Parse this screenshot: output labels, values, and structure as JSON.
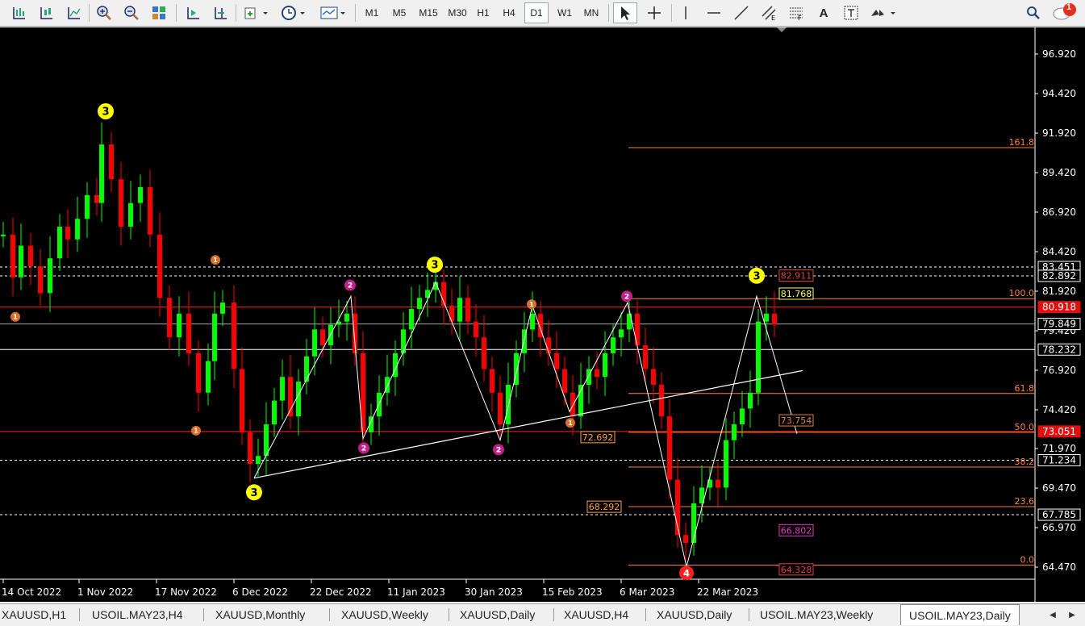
{
  "toolbar": {
    "timeframes": [
      "M1",
      "M5",
      "M15",
      "M30",
      "H1",
      "H4",
      "D1",
      "W1",
      "MN"
    ],
    "active_timeframe": "D1",
    "text_tool_label": "A",
    "notification_count": "1"
  },
  "chart_data": {
    "type": "candlestick",
    "symbol": "USOIL.MAY23",
    "timeframe": "Daily",
    "y_ticks": [
      "96.920",
      "94.420",
      "91.920",
      "89.420",
      "86.920",
      "84.420",
      "81.920",
      "79.420",
      "76.920",
      "74.420",
      "71.970",
      "69.470",
      "66.970",
      "64.470"
    ],
    "y_tick_values": [
      96.92,
      94.42,
      91.92,
      89.42,
      86.92,
      84.42,
      81.92,
      79.42,
      76.92,
      74.42,
      71.97,
      69.47,
      66.97,
      64.47
    ],
    "x_ticks": [
      "14 Oct 2022",
      "1 Nov 2022",
      "17 Nov 2022",
      "6 Dec 2022",
      "22 Dec 2022",
      "11 Jan 2023",
      "30 Jan 2023",
      "15 Feb 2023",
      "6 Mar 2023",
      "22 Mar 2023"
    ],
    "price_labels": [
      {
        "text": "83.451",
        "value": 83.451,
        "style": "white"
      },
      {
        "text": "82.892",
        "value": 82.892,
        "style": "white"
      },
      {
        "text": "80.918",
        "value": 80.918,
        "style": "red"
      },
      {
        "text": "79.849",
        "value": 79.849,
        "style": "white"
      },
      {
        "text": "78.232",
        "value": 78.232,
        "style": "white"
      },
      {
        "text": "73.051",
        "value": 73.051,
        "style": "red"
      },
      {
        "text": "71.234",
        "value": 71.234,
        "style": "white"
      },
      {
        "text": "67.785",
        "value": 67.785,
        "style": "white"
      }
    ],
    "fib_levels": [
      {
        "label": "161.8",
        "value": 91.0
      },
      {
        "label": "100.0",
        "value": 81.45
      },
      {
        "label": "61.8",
        "value": 75.45
      },
      {
        "label": "50.0",
        "value": 73.0
      },
      {
        "label": "38.2",
        "value": 70.8
      },
      {
        "label": "23.6",
        "value": 68.3
      },
      {
        "label": "0.0",
        "value": 64.6
      }
    ],
    "chart_labels": [
      {
        "text": "82.911",
        "value": 82.911,
        "color": "#e04040"
      },
      {
        "text": "81.768",
        "value": 81.768,
        "color": "#ffff66"
      },
      {
        "text": "73.754",
        "value": 73.754,
        "color": "#e08040"
      },
      {
        "text": "72.692",
        "value": 72.692,
        "color": "#ffa040"
      },
      {
        "text": "68.292",
        "value": 68.292,
        "color": "#ffa040"
      },
      {
        "text": "66.802",
        "value": 66.802,
        "color": "#e040c0"
      },
      {
        "text": "64.328",
        "value": 64.328,
        "color": "#e04040"
      }
    ],
    "wave_markers": [
      {
        "text": "3",
        "type": "yellow"
      },
      {
        "text": "3",
        "type": "yellow"
      },
      {
        "text": "3",
        "type": "yellow"
      },
      {
        "text": "3",
        "type": "yellow"
      },
      {
        "text": "2",
        "type": "magenta"
      },
      {
        "text": "2",
        "type": "magenta"
      },
      {
        "text": "2",
        "type": "magenta"
      },
      {
        "text": "2",
        "type": "magenta"
      },
      {
        "text": "1",
        "type": "orange"
      },
      {
        "text": "1",
        "type": "orange"
      },
      {
        "text": "1",
        "type": "orange"
      },
      {
        "text": "1",
        "type": "orange"
      },
      {
        "text": "1",
        "type": "orange"
      },
      {
        "text": "4",
        "type": "red"
      }
    ],
    "colors": {
      "bull": "#00ff00",
      "bear": "#ff0000",
      "background": "#000000",
      "axis_text": "#ffffff",
      "fib": "#ff8040",
      "hline_red": "#ff2020"
    }
  },
  "tabs": {
    "items": [
      "XAUUSD,H1",
      "USOIL.MAY23,H4",
      "XAUUSD,Monthly",
      "XAUUSD,Weekly",
      "XAUUSD,Daily",
      "XAUUSD,H4",
      "XAUUSD,Daily",
      "USOIL.MAY23,Weekly",
      "USOIL.MAY23,Daily"
    ],
    "active_index": 8
  }
}
